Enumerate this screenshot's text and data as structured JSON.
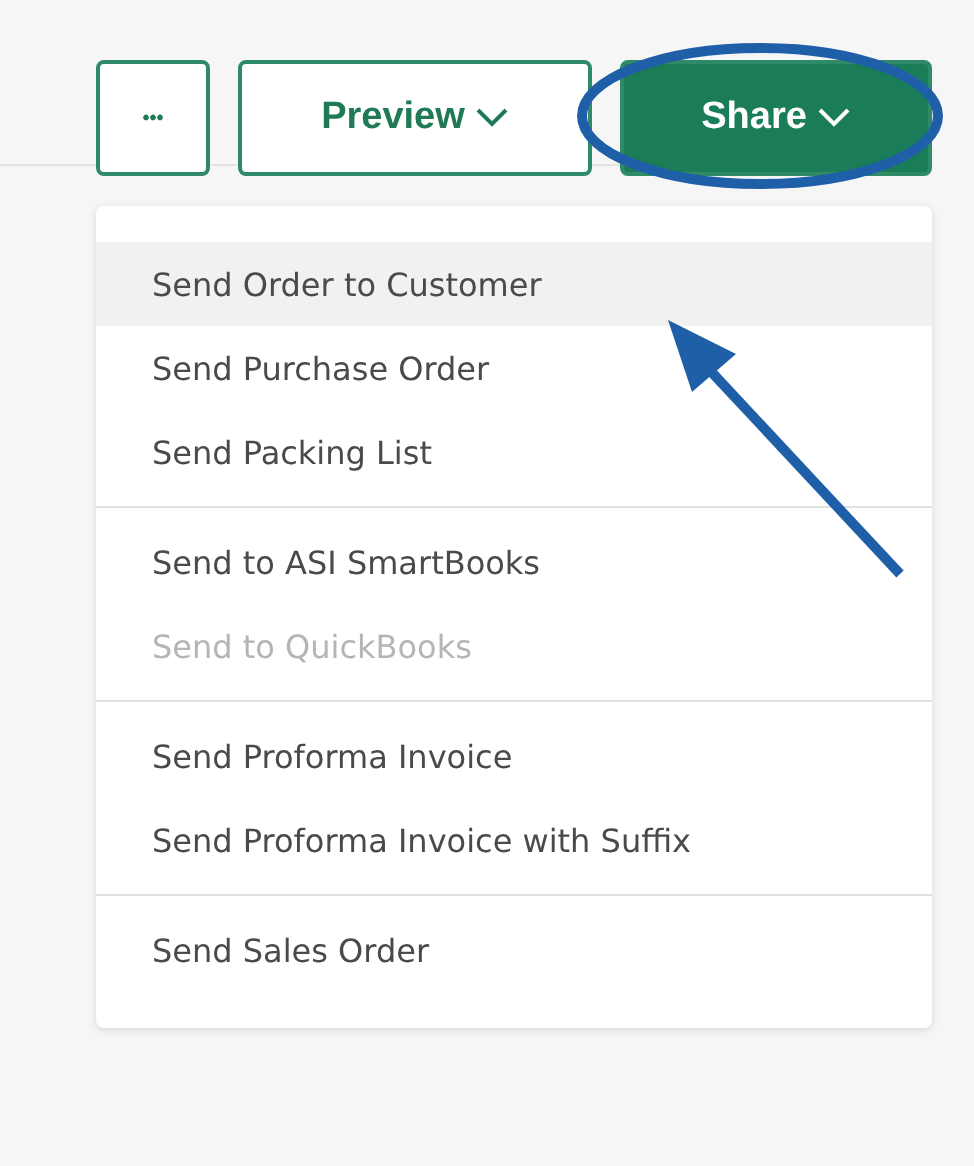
{
  "toolbar": {
    "buttons": [
      {
        "kind": "more",
        "label": "•••"
      },
      {
        "kind": "dropdown",
        "label": "Preview",
        "selected": false
      },
      {
        "kind": "dropdown",
        "label": "Share",
        "selected": true
      }
    ]
  },
  "menu": {
    "groups": [
      {
        "items": [
          {
            "label": "Send Order to Customer",
            "selected": true,
            "disabled": false
          },
          {
            "label": "Send Purchase Order",
            "selected": false,
            "disabled": false
          },
          {
            "label": "Send Packing List",
            "selected": false,
            "disabled": false
          }
        ]
      },
      {
        "items": [
          {
            "label": "Send to ASI SmartBooks",
            "selected": false,
            "disabled": false
          },
          {
            "label": "Send to QuickBooks",
            "selected": false,
            "disabled": true
          }
        ]
      },
      {
        "items": [
          {
            "label": "Send Proforma Invoice",
            "selected": false,
            "disabled": false
          },
          {
            "label": "Send Proforma Invoice with Suffix",
            "selected": false,
            "disabled": false
          }
        ]
      },
      {
        "items": [
          {
            "label": "Send Sales Order",
            "selected": false,
            "disabled": false
          }
        ]
      }
    ]
  }
}
